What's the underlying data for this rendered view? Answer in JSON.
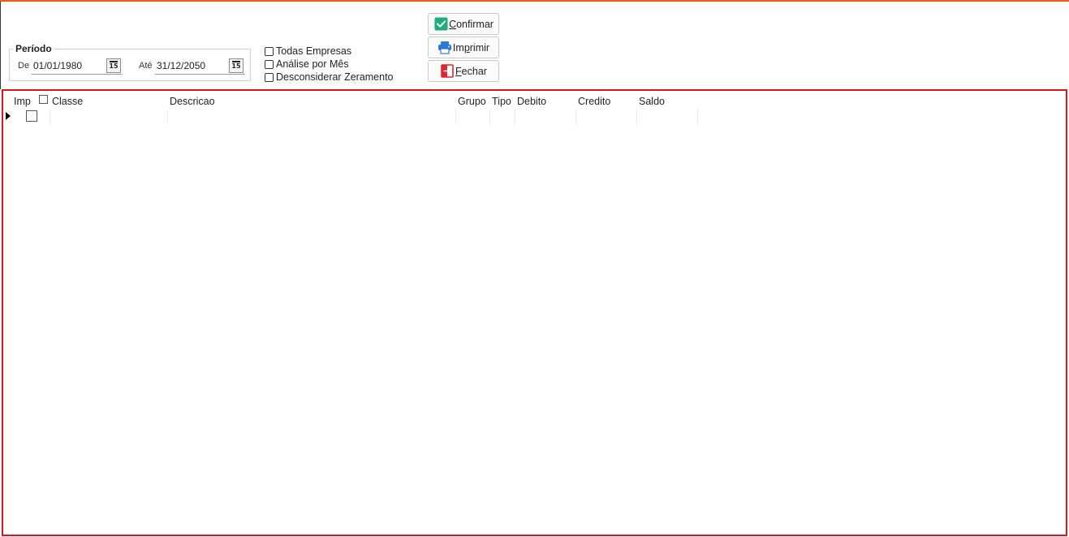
{
  "colors": {
    "accent_top": "#f25c12",
    "grid_border": "#e0141c"
  },
  "periodo": {
    "legend": "Período",
    "de_label": "De",
    "de_value": "01/01/1980",
    "ate_label": "Até",
    "ate_value": "31/12/2050",
    "calendar_icon_text": "15"
  },
  "options": [
    {
      "label": "Todas Empresas",
      "checked": false
    },
    {
      "label": "Análise por Mês",
      "checked": false
    },
    {
      "label": "Desconsiderar Zeramento",
      "checked": false
    }
  ],
  "buttons": {
    "confirmar": {
      "pre": "",
      "mnemonic": "C",
      "post": "onfirmar",
      "icon": "check-icon"
    },
    "imprimir": {
      "pre": "Im",
      "mnemonic": "p",
      "post": "rimir",
      "icon": "printer-icon"
    },
    "fechar": {
      "pre": "",
      "mnemonic": "F",
      "post": "echar",
      "icon": "exit-icon"
    }
  },
  "grid": {
    "columns": [
      "Imp",
      "Classe",
      "Descricao",
      "Grupo",
      "Tipo",
      "Debito",
      "Credito",
      "Saldo"
    ],
    "rows": [
      {
        "imp": false,
        "classe": "",
        "descricao": "",
        "grupo": "",
        "tipo": "",
        "debito": "",
        "credito": "",
        "saldo": ""
      }
    ]
  }
}
